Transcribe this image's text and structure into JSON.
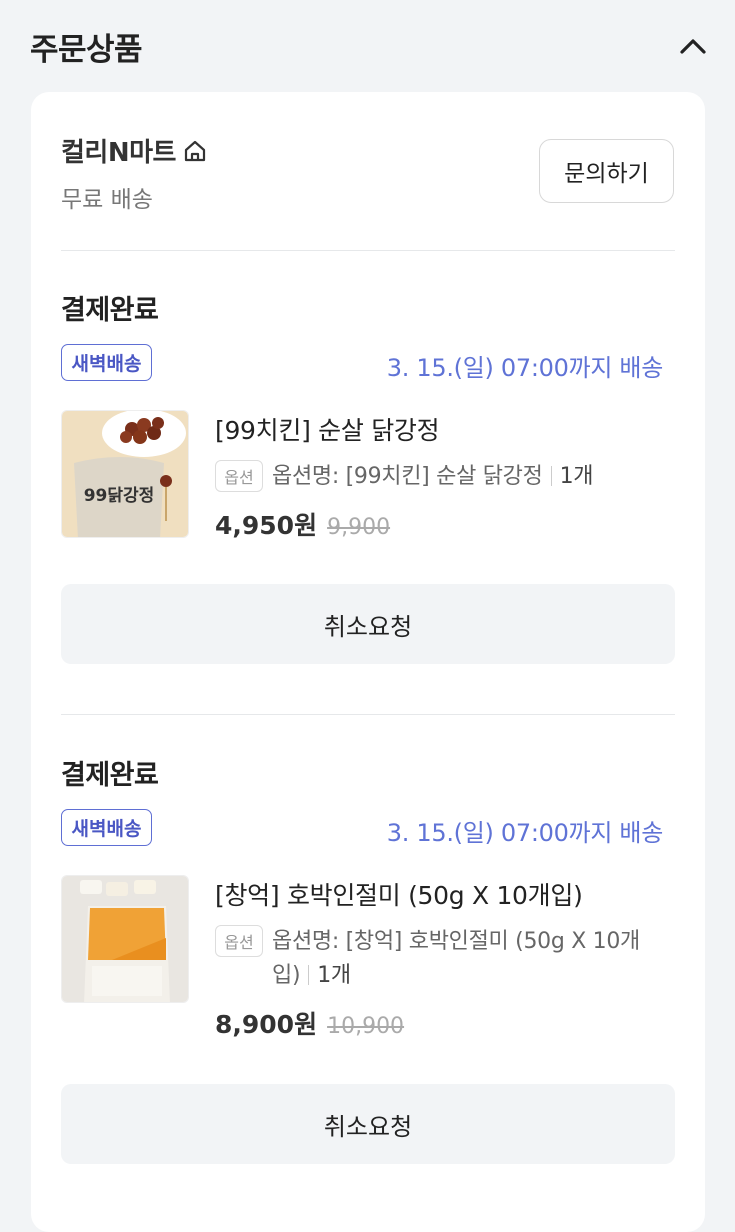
{
  "section": {
    "title": "주문상품"
  },
  "store": {
    "name": "컬리N마트",
    "shipping": "무료 배송",
    "inquiry_label": "문의하기"
  },
  "orders": [
    {
      "status": "결제완료",
      "badge": "새벽배송",
      "delivery": "3. 15.(일) 07:00까지 배송",
      "product_name": "[99치킨] 순살 닭강정",
      "option_tag": "옵션",
      "option_line1": "옵션명: [99치킨] 순살 닭강정",
      "option_line2": "",
      "quantity": "1개",
      "price": "4,950원",
      "original_price": "9,900",
      "cancel_label": "취소요청",
      "thumb_text": "99닭강정"
    },
    {
      "status": "결제완료",
      "badge": "새벽배송",
      "delivery": "3. 15.(일) 07:00까지 배송",
      "product_name": "[창억] 호박인절미 (50g X 10개입)",
      "option_tag": "옵션",
      "option_line1": "옵션명: [창억] 호박인절미 (50g X 10개",
      "option_line2": "입)",
      "quantity": "1개",
      "price": "8,900원",
      "original_price": "10,900",
      "cancel_label": "취소요청",
      "thumb_text": ""
    }
  ],
  "colors": {
    "accent_blue": "#5f73d6",
    "badge_border": "#5f6fd4",
    "background": "#f2f4f6"
  }
}
